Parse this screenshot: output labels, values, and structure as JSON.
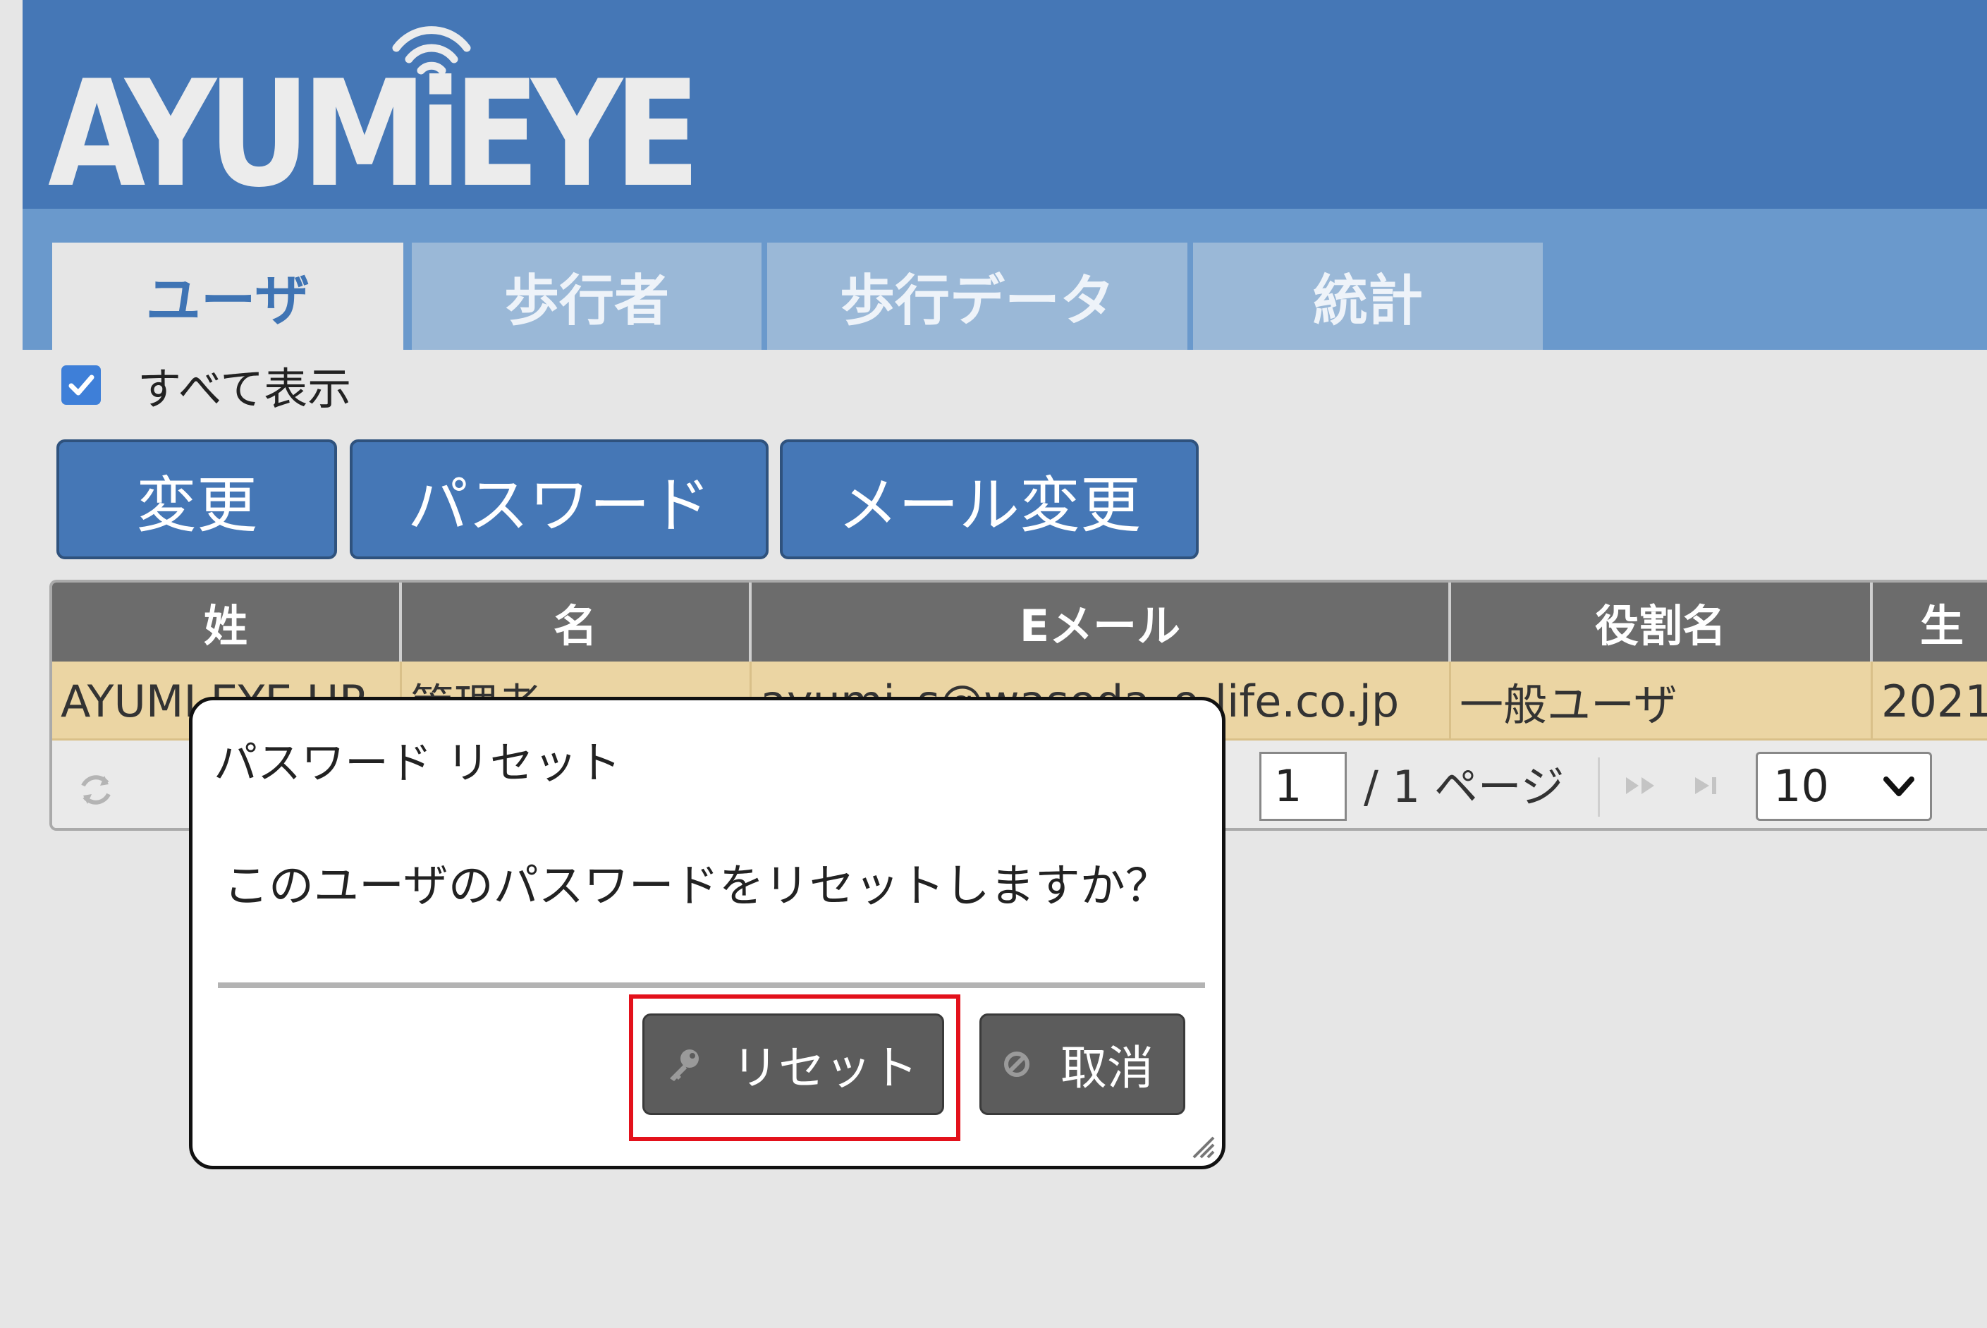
{
  "brand": {
    "logo_text": "AYUMiEYE"
  },
  "tabs": [
    {
      "label": "ユーザ",
      "active": true
    },
    {
      "label": "歩行者",
      "active": false
    },
    {
      "label": "歩行データ",
      "active": false
    },
    {
      "label": "統計",
      "active": false
    }
  ],
  "filter": {
    "show_all_label": "すべて表示",
    "checked": true
  },
  "toolbar": {
    "change_label": "変更",
    "password_label": "パスワード",
    "mail_change_label": "メール変更"
  },
  "table": {
    "columns": [
      "姓",
      "名",
      "Eメール",
      "役割名",
      "生"
    ],
    "rows": [
      [
        "AYUMI EYE HP",
        "管理者",
        "ayumi_s@waseda_e-life.co.jp",
        "一般ユーザ",
        "2021"
      ]
    ]
  },
  "pager": {
    "page_value": "1",
    "page_total_text": "/ 1 ページ",
    "page_size": "10"
  },
  "dialog": {
    "title": "パスワード リセット",
    "message": "このユーザのパスワードをリセットしますか？",
    "reset_label": "リセット",
    "cancel_label": "取消"
  },
  "colors": {
    "header": "#4577b6",
    "tabbar": "#6a99cc",
    "tab_inactive": "#9ab8d7",
    "button": "#4577b6",
    "row_selected": "#ebd5a3",
    "dialog_button": "#5c5c5c",
    "highlight": "#e3111b"
  }
}
